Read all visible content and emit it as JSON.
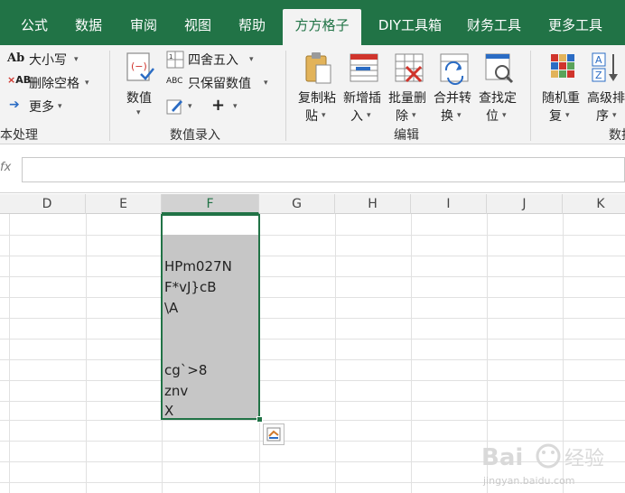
{
  "tabs": [
    {
      "label": "公式",
      "active": false
    },
    {
      "label": "数据",
      "active": false
    },
    {
      "label": "审阅",
      "active": false
    },
    {
      "label": "视图",
      "active": false
    },
    {
      "label": "帮助",
      "active": false
    },
    {
      "label": "方方格子",
      "active": true
    },
    {
      "label": "DIY工具箱",
      "active": false
    },
    {
      "label": "财务工具",
      "active": false
    },
    {
      "label": "更多工具",
      "active": false
    }
  ],
  "ribbon": {
    "text_group": {
      "case_label": "大小写",
      "remove_spaces_label": "删除空格",
      "more_label": "更多",
      "group_label": "本处理"
    },
    "numeric_group": {
      "value_label": "数值",
      "round_label": "四舍五入",
      "keep_values_label": "只保留数值",
      "plus_label": "+",
      "group_label": "数值录入"
    },
    "edit_group": {
      "copy_paste_label_1": "复制粘",
      "copy_paste_label_2": "贴",
      "batch_insert_label_1": "新增插",
      "batch_insert_label_2": "入",
      "batch_delete_label_1": "批量删",
      "batch_delete_label_2": "除",
      "merge_convert_label_1": "合并转",
      "merge_convert_label_2": "换",
      "find_locate_label_1": "查找定",
      "find_locate_label_2": "位",
      "group_label": "编辑"
    },
    "data_group": {
      "random_repeat_label_1": "随机重",
      "random_repeat_label_2": "复",
      "advanced_sort_label_1": "高级排",
      "advanced_sort_label_2": "序",
      "group_label": "数技"
    }
  },
  "formula_bar": {
    "fx_label": "fx",
    "value": ""
  },
  "columns": [
    "D",
    "E",
    "F",
    "G",
    "H",
    "I",
    "J",
    "K"
  ],
  "selected_column": "F",
  "cells_F": [
    "",
    "",
    "HPm027N",
    "F*vJ}cB",
    "\\A",
    "",
    "",
    "cg`>8",
    "znv",
    "X"
  ],
  "watermark": {
    "brand": "Bai",
    "brand_cn": "经验",
    "url": "jingyan.baidu.com"
  },
  "colors": {
    "accent": "#217346",
    "selection": "#c6c6c6"
  }
}
